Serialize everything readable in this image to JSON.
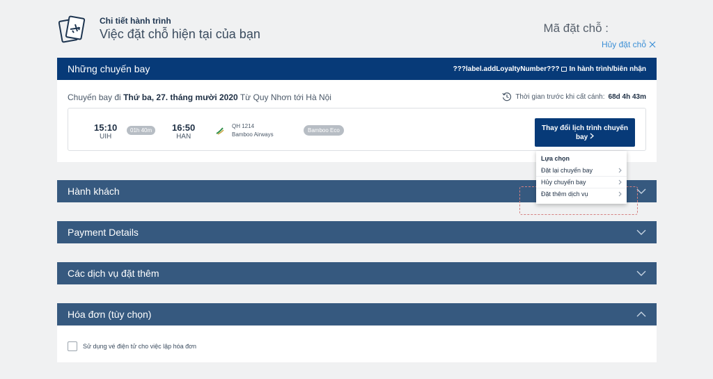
{
  "header": {
    "subtitle_small": "Chi tiết hành trình",
    "title": "Việc đặt chỗ hiện tại của bạn",
    "booking_code_label": "Mã đặt chỗ :",
    "cancel_link": "Hủy đặt chỗ",
    "icon": "boarding-pass-icon"
  },
  "flights": {
    "bar_title": "Những chuyến bay",
    "loyalty_label": "???label.addLoyaltyNumber???",
    "print_label": "In hành trình/biên nhận",
    "route_prefix": "Chuyến bay đi",
    "route_date": "Thứ ba, 27. tháng mười 2020",
    "route_rest": "Từ Quy Nhơn tới Hà Nội",
    "time_before_label": "Thời gian trước khi cất cánh:",
    "time_before_value": "68d 4h 43m",
    "segment": {
      "dep_time": "15:10",
      "dep_code": "UIH",
      "duration": "01h 40m",
      "arr_time": "16:50",
      "arr_code": "HAN",
      "flight_no": "QH 1214",
      "airline": "Bamboo Airways",
      "fare": "Bamboo Eco"
    },
    "change_button": "Thay đổi lịch trình chuyến bay"
  },
  "dropdown": {
    "heading": "Lựa chọn",
    "items": [
      "Đặt lại chuyến bay",
      "Hủy chuyến bay",
      "Đặt thêm dịch vụ"
    ]
  },
  "sections": {
    "passengers": "Hành khách",
    "payment": "Payment Details",
    "extras": "Các dịch vụ đặt thêm",
    "invoice": "Hóa đơn (tùy chọn)"
  },
  "invoice": {
    "checkbox_label": "Sử dụng vé điện tử cho việc lập hóa đơn",
    "checked": false
  },
  "colors": {
    "primary_navy": "#073a78",
    "section_bar": "#36597f",
    "link_blue": "#3b8fd6",
    "background": "#f0f1f2"
  }
}
